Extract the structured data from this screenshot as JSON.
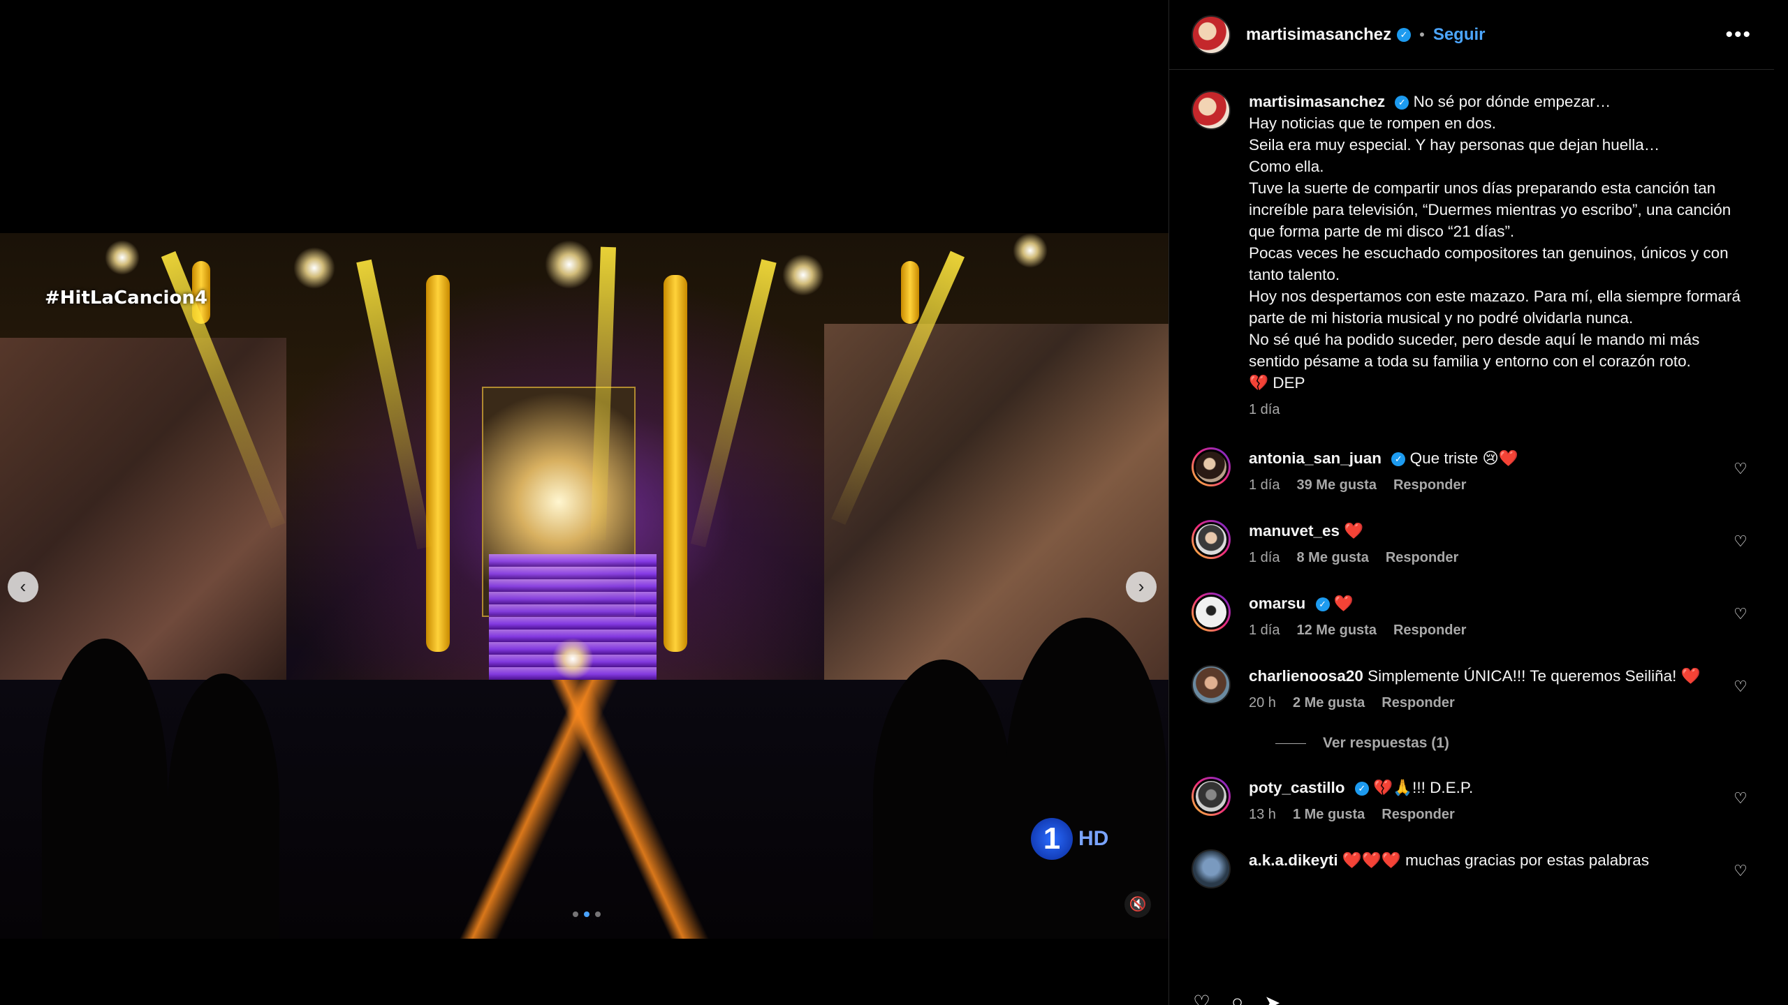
{
  "video": {
    "hashtag": "#HitLaCancion4",
    "channel_logo_number": "1",
    "channel_logo_hd": "HD",
    "carousel_total": 3,
    "carousel_active_index": 1
  },
  "header": {
    "username": "martisimasanchez",
    "verified_icon": "✓",
    "separator": "•",
    "follow_label": "Seguir",
    "more_label": "•••"
  },
  "caption": {
    "username": "martisimasanchez",
    "text": "No sé por dónde empezar…\nHay noticias que te rompen en dos.\nSeila era muy especial. Y hay personas que dejan huella…\nComo ella.\nTuve la suerte de compartir unos días preparando esta canción tan increíble para televisión, “Duermes mientras yo escribo”, una canción que forma parte de mi disco “21 días”.\nPocas veces he escuchado compositores tan genuinos, únicos y con tanto talento.\nHoy nos despertamos con este mazazo. Para mí, ella siempre formará parte de mi historia musical y no podré olvidarla nunca.\nNo sé qué ha podido suceder, pero desde aquí le mando mi más sentido pésame a toda su familia y entorno con el corazón roto.\n💔 DEP",
    "time": "1 día"
  },
  "comments": [
    {
      "username": "antonia_san_juan",
      "text": "Que triste 😢❤️",
      "time": "1 día",
      "likes": "39 Me gusta",
      "reply": "Responder"
    },
    {
      "username": "manuvet_es",
      "text": "❤️",
      "time": "1 día",
      "likes": "8 Me gusta",
      "reply": "Responder"
    },
    {
      "username": "omarsu",
      "text": "❤️",
      "time": "1 día",
      "likes": "12 Me gusta",
      "reply": "Responder"
    },
    {
      "username": "charlienoosa20",
      "text": "Simplemente ÚNICA!!! Te queremos Seiliña! ❤️",
      "time": "20 h",
      "likes": "2 Me gusta",
      "reply": "Responder"
    },
    {
      "username": "poty_castillo",
      "text": "💔🙏!!! D.E.P.",
      "time": "13 h",
      "likes": "1 Me gusta",
      "reply": "Responder"
    },
    {
      "username": "a.k.a.dikeyti",
      "text": "❤️❤️❤️ muchas gracias por estas palabras"
    }
  ],
  "view_replies_label": "Ver respuestas (1)",
  "icons": {
    "prev": "‹",
    "next": "›",
    "mute": "🔇",
    "heart": "♡"
  }
}
